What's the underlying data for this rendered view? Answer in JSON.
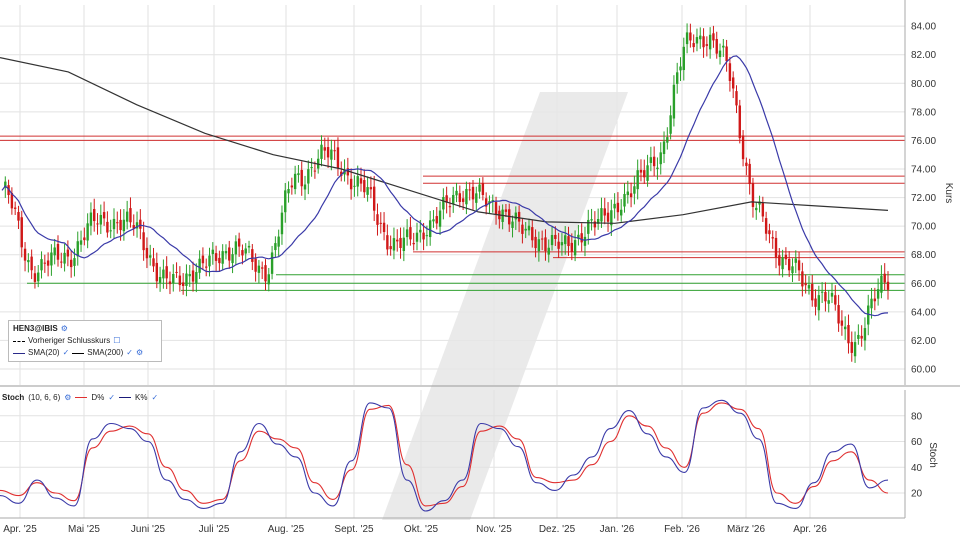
{
  "colors": {
    "up": "#2aa02a",
    "down": "#d01818",
    "sma20": "#3a3aa8",
    "sma200": "#333333",
    "resistance": "#d03030",
    "support": "#30a030",
    "stoch_k": "#3a3aa8",
    "stoch_d": "#e03030",
    "grid": "#e2e2e2"
  },
  "legend": {
    "symbol": "HEN3@IBIS",
    "prev_close": "Vorheriger Schlusskurs",
    "sma20": "SMA(20)",
    "sma200": "SMA(200)"
  },
  "stoch_legend": {
    "name": "Stoch",
    "params": "(10, 6, 6)",
    "d": "D%",
    "k": "K%"
  },
  "chart_data": [
    {
      "type": "candlestick",
      "ylabel": "Kurs",
      "ylim": [
        59,
        85
      ],
      "y_ticks": [
        "60.00",
        "62.00",
        "64.00",
        "66.00",
        "68.00",
        "70.00",
        "72.00",
        "74.00",
        "76.00",
        "78.00",
        "80.00",
        "82.00",
        "84.00"
      ],
      "x_ticks": [
        "Apr. '25",
        "Mai '25",
        "Juni '25",
        "Juli '25",
        "Aug. '25",
        "Sept. '25",
        "Okt. '25",
        "Nov. '25",
        "Dez. '25",
        "Jan. '26",
        "Feb. '26",
        "März '26",
        "Apr. '26"
      ],
      "grid": true,
      "legend_position": "bottom-left",
      "horizontal_lines": {
        "resistance": [
          76.3,
          76.0,
          73.5,
          73.0,
          68.2,
          67.8
        ],
        "support": [
          66.6,
          66.0,
          65.5
        ]
      },
      "close_anchors": [
        {
          "date": "Apr. '25",
          "close": 72.5
        },
        {
          "date": "Mitte Apr. '25",
          "close": 67.0
        },
        {
          "date": "Mai '25",
          "close": 68.0
        },
        {
          "date": "Mitte Mai '25",
          "close": 70.5
        },
        {
          "date": "Juni '25",
          "close": 70.0
        },
        {
          "date": "Mitte Juni '25",
          "close": 66.0
        },
        {
          "date": "Juli '25",
          "close": 67.0
        },
        {
          "date": "Mitte Juli '25",
          "close": 68.5
        },
        {
          "date": "Aug. '25",
          "close": 67.0
        },
        {
          "date": "Mitte Aug. '25",
          "close": 73.5
        },
        {
          "date": "Sept. '25",
          "close": 75.0
        },
        {
          "date": "Mitte Sept. '25",
          "close": 72.5
        },
        {
          "date": "Okt. '25",
          "close": 68.5
        },
        {
          "date": "Mitte Okt. '25",
          "close": 70.0
        },
        {
          "date": "Nov. '25",
          "close": 72.5
        },
        {
          "date": "Mitte Nov. '25",
          "close": 71.5
        },
        {
          "date": "Dez. '25",
          "close": 69.5
        },
        {
          "date": "Mitte Dez. '25",
          "close": 68.5
        },
        {
          "date": "Jan. '26",
          "close": 70.0
        },
        {
          "date": "Mitte Jan. '26",
          "close": 72.0
        },
        {
          "date": "Feb. '26",
          "close": 75.0
        },
        {
          "date": "Mitte Feb. '26",
          "close": 83.5
        },
        {
          "date": "März '26",
          "close": 82.0
        },
        {
          "date": "Mitte März '26",
          "close": 71.0
        },
        {
          "date": "Apr. '26",
          "close": 67.0
        },
        {
          "date": "Mitte Apr. '26",
          "close": 65.0
        },
        {
          "date": "Ende Apr. '26",
          "close": 62.0
        },
        {
          "date": "Letzter",
          "close": 66.5
        }
      ],
      "sma200_anchors": [
        81.8,
        80.8,
        78.5,
        76.5,
        75.0,
        74.0,
        72.5,
        71.0,
        70.3,
        70.2,
        70.8,
        71.7,
        71.4,
        71.1
      ]
    },
    {
      "type": "line",
      "name": "Stoch",
      "params": "(10, 6, 6)",
      "ylim": [
        0,
        100
      ],
      "y_ticks": [
        "20",
        "40",
        "60",
        "80"
      ],
      "ylabel": "Stoch",
      "series": [
        {
          "name": "D%",
          "values": [
            22,
            18,
            28,
            20,
            14,
            55,
            68,
            72,
            66,
            40,
            22,
            12,
            15,
            45,
            68,
            62,
            55,
            28,
            15,
            38,
            85,
            88,
            42,
            10,
            12,
            25,
            68,
            72,
            62,
            32,
            28,
            30,
            42,
            60,
            80,
            72,
            55,
            40,
            82,
            90,
            85,
            70,
            20,
            12,
            25,
            45,
            52,
            30,
            20
          ]
        },
        {
          "name": "K%",
          "values": [
            18,
            12,
            30,
            16,
            10,
            62,
            74,
            70,
            60,
            30,
            15,
            8,
            12,
            52,
            74,
            58,
            48,
            20,
            10,
            45,
            90,
            86,
            30,
            6,
            14,
            30,
            74,
            70,
            56,
            28,
            22,
            34,
            48,
            70,
            84,
            66,
            48,
            36,
            86,
            92,
            82,
            62,
            12,
            8,
            28,
            52,
            58,
            24,
            30
          ]
        }
      ]
    }
  ]
}
